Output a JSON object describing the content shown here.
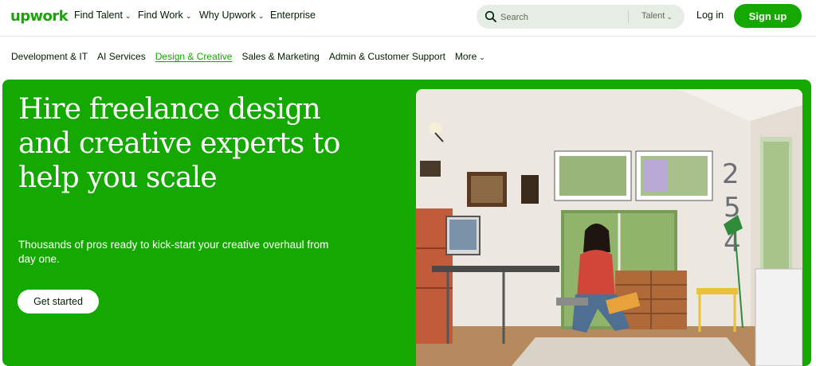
{
  "header": {
    "logo": "upwork",
    "nav": [
      {
        "label": "Find Talent",
        "dropdown": true
      },
      {
        "label": "Find Work",
        "dropdown": true
      },
      {
        "label": "Why Upwork",
        "dropdown": true
      },
      {
        "label": "Enterprise",
        "dropdown": false
      }
    ],
    "search": {
      "placeholder": "Search",
      "type": "Talent"
    },
    "login": "Log in",
    "signup": "Sign up"
  },
  "categories": {
    "items": [
      "Development & IT",
      "AI Services",
      "Design & Creative",
      "Sales & Marketing",
      "Admin & Customer Support"
    ],
    "active": "Design & Creative",
    "more": "More"
  },
  "hero": {
    "title": "Hire freelance design and creative experts to help you scale",
    "subtitle": "Thousands of pros ready to kick-start your creative overhaul from day one.",
    "cta": "Get started",
    "wall_numbers": [
      "2",
      "5",
      "4"
    ]
  },
  "colors": {
    "brand": "#14a800",
    "text": "#001e00",
    "search_bg": "#e5ede5"
  }
}
